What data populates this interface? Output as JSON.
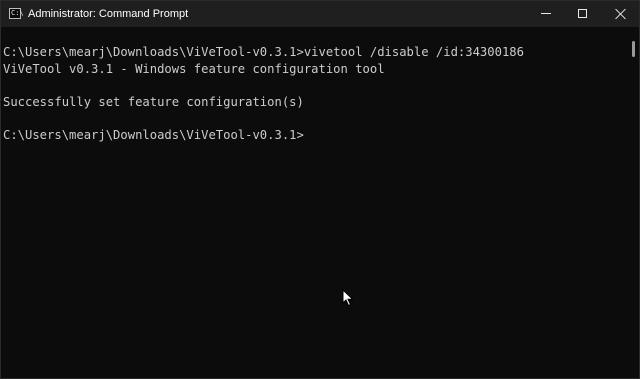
{
  "window": {
    "title": "Administrator: Command Prompt",
    "icon": "cmd-icon",
    "icon_glyph": "C:\\"
  },
  "controls": {
    "minimize_icon": "minimize-icon",
    "maximize_icon": "maximize-icon",
    "close_icon": "close-icon"
  },
  "console": {
    "lines": [
      "C:\\Users\\mearj\\Downloads\\ViVeTool-v0.3.1>vivetool /disable /id:34300186",
      "ViVeTool v0.3.1 - Windows feature configuration tool",
      "Successfully set feature configuration(s)",
      "C:\\Users\\mearj\\Downloads\\ViVeTool-v0.3.1>"
    ]
  },
  "colors": {
    "background": "#0c0c0c",
    "titlebar": "#1f1f1f",
    "text": "#cccccc"
  }
}
